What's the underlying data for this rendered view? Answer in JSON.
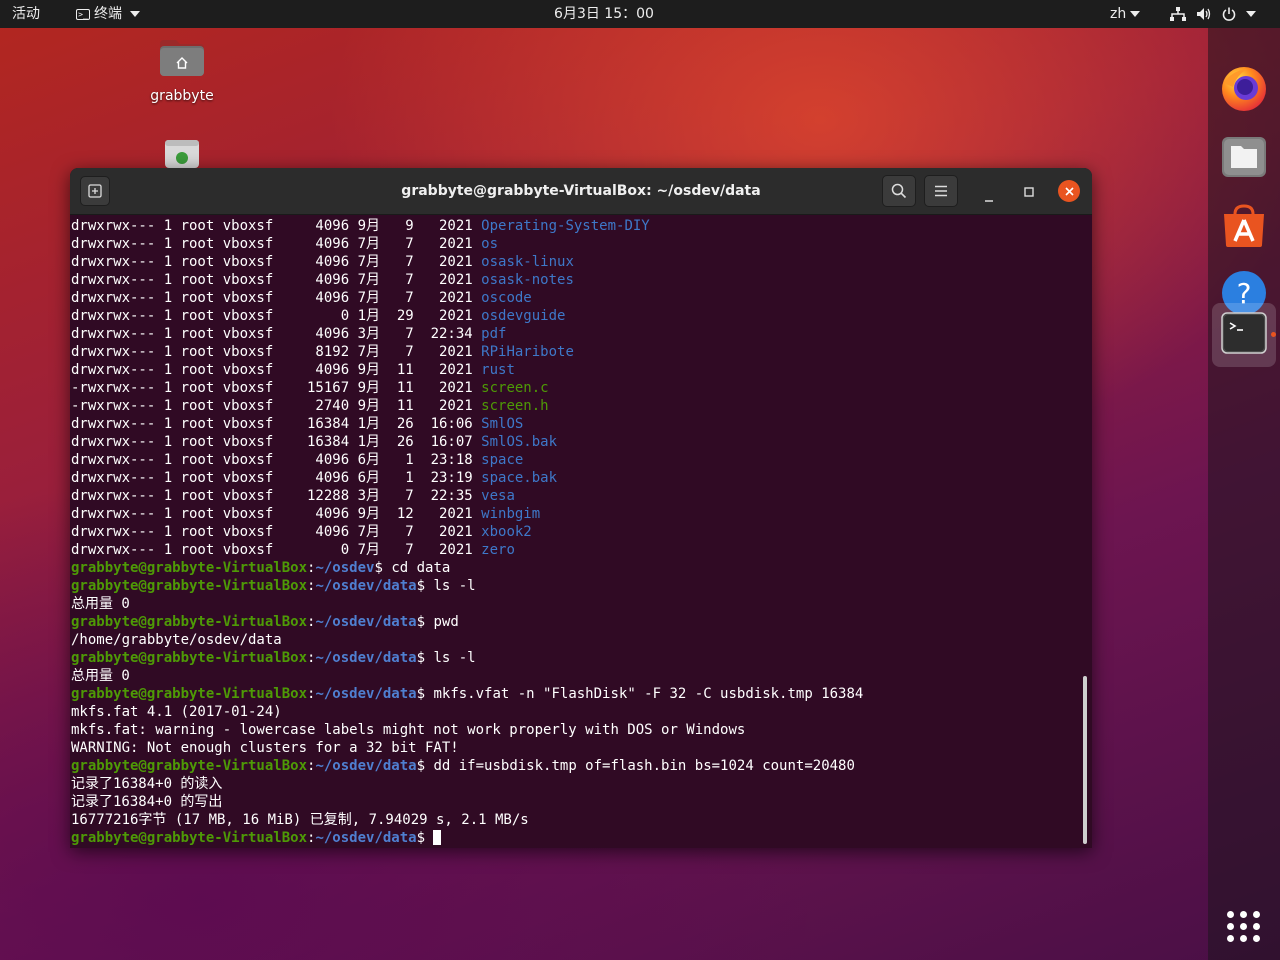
{
  "topbar": {
    "activities": "活动",
    "app_menu": "终端",
    "clock": "6月3日 15：00",
    "lang": "zh"
  },
  "desktop": {
    "home_label": "grabbyte"
  },
  "window": {
    "title": "grabbyte@grabbyte-VirtualBox: ~/osdev/data"
  },
  "terminal": {
    "listing": [
      {
        "perm": "drwxrwx---",
        "links": "1",
        "owner": "root",
        "group": "vboxsf",
        "size": "4096",
        "month": "9月",
        "day": "9",
        "time": "2021",
        "name": "Operating-System-DIY",
        "kind": "dir"
      },
      {
        "perm": "drwxrwx---",
        "links": "1",
        "owner": "root",
        "group": "vboxsf",
        "size": "4096",
        "month": "7月",
        "day": "7",
        "time": "2021",
        "name": "os",
        "kind": "dir"
      },
      {
        "perm": "drwxrwx---",
        "links": "1",
        "owner": "root",
        "group": "vboxsf",
        "size": "4096",
        "month": "7月",
        "day": "7",
        "time": "2021",
        "name": "osask-linux",
        "kind": "dir"
      },
      {
        "perm": "drwxrwx---",
        "links": "1",
        "owner": "root",
        "group": "vboxsf",
        "size": "4096",
        "month": "7月",
        "day": "7",
        "time": "2021",
        "name": "osask-notes",
        "kind": "dir"
      },
      {
        "perm": "drwxrwx---",
        "links": "1",
        "owner": "root",
        "group": "vboxsf",
        "size": "4096",
        "month": "7月",
        "day": "7",
        "time": "2021",
        "name": "oscode",
        "kind": "dir"
      },
      {
        "perm": "drwxrwx---",
        "links": "1",
        "owner": "root",
        "group": "vboxsf",
        "size": "0",
        "month": "1月",
        "day": "29",
        "time": "2021",
        "name": "osdevguide",
        "kind": "dir"
      },
      {
        "perm": "drwxrwx---",
        "links": "1",
        "owner": "root",
        "group": "vboxsf",
        "size": "4096",
        "month": "3月",
        "day": "7",
        "time": "22:34",
        "name": "pdf",
        "kind": "dir"
      },
      {
        "perm": "drwxrwx---",
        "links": "1",
        "owner": "root",
        "group": "vboxsf",
        "size": "8192",
        "month": "7月",
        "day": "7",
        "time": "2021",
        "name": "RPiHaribote",
        "kind": "dir"
      },
      {
        "perm": "drwxrwx---",
        "links": "1",
        "owner": "root",
        "group": "vboxsf",
        "size": "4096",
        "month": "9月",
        "day": "11",
        "time": "2021",
        "name": "rust",
        "kind": "dir"
      },
      {
        "perm": "-rwxrwx---",
        "links": "1",
        "owner": "root",
        "group": "vboxsf",
        "size": "15167",
        "month": "9月",
        "day": "11",
        "time": "2021",
        "name": "screen.c",
        "kind": "file"
      },
      {
        "perm": "-rwxrwx---",
        "links": "1",
        "owner": "root",
        "group": "vboxsf",
        "size": "2740",
        "month": "9月",
        "day": "11",
        "time": "2021",
        "name": "screen.h",
        "kind": "file"
      },
      {
        "perm": "drwxrwx---",
        "links": "1",
        "owner": "root",
        "group": "vboxsf",
        "size": "16384",
        "month": "1月",
        "day": "26",
        "time": "16:06",
        "name": "SmlOS",
        "kind": "dir"
      },
      {
        "perm": "drwxrwx---",
        "links": "1",
        "owner": "root",
        "group": "vboxsf",
        "size": "16384",
        "month": "1月",
        "day": "26",
        "time": "16:07",
        "name": "SmlOS.bak",
        "kind": "dir"
      },
      {
        "perm": "drwxrwx---",
        "links": "1",
        "owner": "root",
        "group": "vboxsf",
        "size": "4096",
        "month": "6月",
        "day": "1",
        "time": "23:18",
        "name": "space",
        "kind": "dir"
      },
      {
        "perm": "drwxrwx---",
        "links": "1",
        "owner": "root",
        "group": "vboxsf",
        "size": "4096",
        "month": "6月",
        "day": "1",
        "time": "23:19",
        "name": "space.bak",
        "kind": "dir"
      },
      {
        "perm": "drwxrwx---",
        "links": "1",
        "owner": "root",
        "group": "vboxsf",
        "size": "12288",
        "month": "3月",
        "day": "7",
        "time": "22:35",
        "name": "vesa",
        "kind": "dir"
      },
      {
        "perm": "drwxrwx---",
        "links": "1",
        "owner": "root",
        "group": "vboxsf",
        "size": "4096",
        "month": "9月",
        "day": "12",
        "time": "2021",
        "name": "winbgim",
        "kind": "dir"
      },
      {
        "perm": "drwxrwx---",
        "links": "1",
        "owner": "root",
        "group": "vboxsf",
        "size": "4096",
        "month": "7月",
        "day": "7",
        "time": "2021",
        "name": "xbook2",
        "kind": "dir"
      },
      {
        "perm": "drwxrwx---",
        "links": "1",
        "owner": "root",
        "group": "vboxsf",
        "size": "0",
        "month": "7月",
        "day": "7",
        "time": "2021",
        "name": "zero",
        "kind": "dir"
      }
    ],
    "session": [
      {
        "type": "prompt",
        "user": "grabbyte@grabbyte-VirtualBox",
        "path": "~/osdev",
        "cmd": "cd data"
      },
      {
        "type": "prompt",
        "user": "grabbyte@grabbyte-VirtualBox",
        "path": "~/osdev/data",
        "cmd": "ls -l"
      },
      {
        "type": "output",
        "text": "总用量 0"
      },
      {
        "type": "prompt",
        "user": "grabbyte@grabbyte-VirtualBox",
        "path": "~/osdev/data",
        "cmd": "pwd"
      },
      {
        "type": "output",
        "text": "/home/grabbyte/osdev/data"
      },
      {
        "type": "prompt",
        "user": "grabbyte@grabbyte-VirtualBox",
        "path": "~/osdev/data",
        "cmd": "ls -l"
      },
      {
        "type": "output",
        "text": "总用量 0"
      },
      {
        "type": "prompt",
        "user": "grabbyte@grabbyte-VirtualBox",
        "path": "~/osdev/data",
        "cmd": "mkfs.vfat -n \"FlashDisk\" -F 32 -C usbdisk.tmp 16384"
      },
      {
        "type": "output",
        "text": "mkfs.fat 4.1 (2017-01-24)"
      },
      {
        "type": "output",
        "text": "mkfs.fat: warning - lowercase labels might not work properly with DOS or Windows"
      },
      {
        "type": "output",
        "text": "WARNING: Not enough clusters for a 32 bit FAT!"
      },
      {
        "type": "prompt",
        "user": "grabbyte@grabbyte-VirtualBox",
        "path": "~/osdev/data",
        "cmd": "dd if=usbdisk.tmp of=flash.bin bs=1024 count=20480"
      },
      {
        "type": "output",
        "text": "记录了16384+0 的读入"
      },
      {
        "type": "output",
        "text": "记录了16384+0 的写出"
      },
      {
        "type": "output",
        "text": "16777216字节 (17 MB, 16 MiB) 已复制, 7.94029 s, 2.1 MB/s"
      },
      {
        "type": "prompt",
        "user": "grabbyte@grabbyte-VirtualBox",
        "path": "~/osdev/data",
        "cmd": "",
        "cursor": true
      }
    ]
  },
  "colors": {
    "terminal_bg": "#300a24",
    "dir": "#3e78c9",
    "exec_file": "#4e9a06",
    "prompt_user": "#4e9a06",
    "prompt_path": "#4f7fd0",
    "accent": "#e95420"
  },
  "icons": {
    "dock": [
      "firefox-icon",
      "files-icon",
      "software-icon",
      "help-icon",
      "terminal-icon",
      "show-apps-icon"
    ],
    "topbar": [
      "network-icon",
      "volume-icon",
      "power-icon"
    ]
  }
}
